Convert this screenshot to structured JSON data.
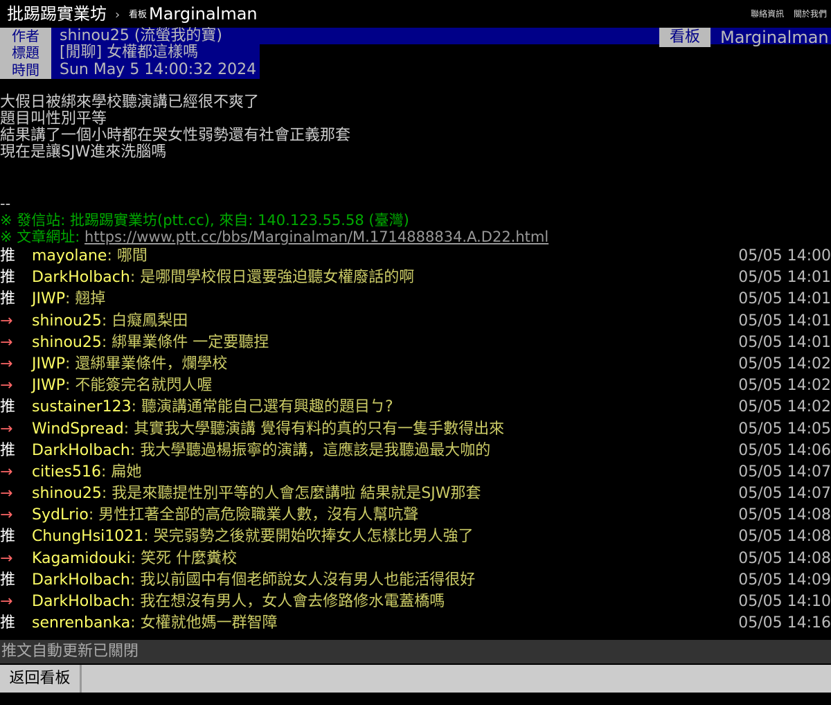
{
  "topbar": {
    "site": "批踢踢實業坊",
    "separator": "›",
    "board_label": "看板",
    "board_name": "Marginalman",
    "links": [
      "聯絡資訊",
      "關於我們"
    ]
  },
  "header": {
    "author_tag": "作者",
    "author": "shinou25 (流螢我的寶)",
    "title_tag": "標題",
    "title": "[閒聊] 女權都這樣嗎",
    "time_tag": "時間",
    "time": "Sun May  5 14:00:32 2024",
    "board_tag": "看板",
    "board": "Marginalman"
  },
  "content": {
    "lines": [
      "大假日被綁來學校聽演講已經很不爽了",
      "題目叫性別平等",
      "結果講了一個小時都在哭女性弱勢還有社會正義那套",
      "現在是讓SJW進來洗腦嗎"
    ]
  },
  "signature": {
    "dash": "--",
    "site_line": "※ 發信站: 批踢踢實業坊(ptt.cc), 來自: 140.123.55.58 (臺灣)",
    "url_label": "※ 文章網址: ",
    "url": "https://www.ptt.cc/bbs/Marginalman/M.1714888834.A.D22.html"
  },
  "pushes": [
    {
      "tag": "推",
      "user": "mayolane",
      "content": ": 哪間",
      "time": "05/05 14:00"
    },
    {
      "tag": "推",
      "user": "DarkHolbach",
      "content": ": 是哪間學校假日還要強迫聽女權廢話的啊",
      "time": "05/05 14:01"
    },
    {
      "tag": "推",
      "user": "JIWP",
      "content": ": 翹掉",
      "time": "05/05 14:01"
    },
    {
      "tag": "→",
      "user": "shinou25",
      "content": ": 白癡鳳梨田",
      "time": "05/05 14:01"
    },
    {
      "tag": "→",
      "user": "shinou25",
      "content": ": 綁畢業條件 一定要聽捏",
      "time": "05/05 14:01"
    },
    {
      "tag": "→",
      "user": "JIWP",
      "content": ": 還綁畢業條件，爛學校",
      "time": "05/05 14:02"
    },
    {
      "tag": "→",
      "user": "JIWP",
      "content": ": 不能簽完名就閃人喔",
      "time": "05/05 14:02"
    },
    {
      "tag": "推",
      "user": "sustainer123",
      "content": ": 聽演講通常能自己選有興趣的題目ㄅ?",
      "time": "05/05 14:02"
    },
    {
      "tag": "→",
      "user": "WindSpread",
      "content": ": 其實我大學聽演講 覺得有料的真的只有一隻手數得出來",
      "time": "05/05 14:05"
    },
    {
      "tag": "推",
      "user": "DarkHolbach",
      "content": ": 我大學聽過楊振寧的演講，這應該是我聽過最大咖的",
      "time": "05/05 14:06"
    },
    {
      "tag": "→",
      "user": "cities516",
      "content": ": 扁她",
      "time": "05/05 14:07"
    },
    {
      "tag": "→",
      "user": "shinou25",
      "content": ": 我是來聽提性別平等的人會怎麼講啦 結果就是SJW那套",
      "time": "05/05 14:07"
    },
    {
      "tag": "→",
      "user": "SydLrio",
      "content": ": 男性扛著全部的高危險職業人數，沒有人幫吭聲",
      "time": "05/05 14:08"
    },
    {
      "tag": "推",
      "user": "ChungHsi1021",
      "content": ": 哭完弱勢之後就要開始吹捧女人怎樣比男人強了",
      "time": "05/05 14:08"
    },
    {
      "tag": "→",
      "user": "Kagamidouki",
      "content": ": 笑死 什麼糞校",
      "time": "05/05 14:08"
    },
    {
      "tag": "推",
      "user": "DarkHolbach",
      "content": ": 我以前國中有個老師說女人沒有男人也能活得很好",
      "time": "05/05 14:09"
    },
    {
      "tag": "→",
      "user": "DarkHolbach",
      "content": ": 我在想沒有男人，女人會去修路修水電蓋橋嗎",
      "time": "05/05 14:10"
    },
    {
      "tag": "推",
      "user": "senrenbanka",
      "content": ": 女權就他媽一群智障",
      "time": "05/05 14:16"
    }
  ],
  "status": {
    "text": "推文自動更新已關閉"
  },
  "bottombar": {
    "back_label": "返回看板"
  }
}
